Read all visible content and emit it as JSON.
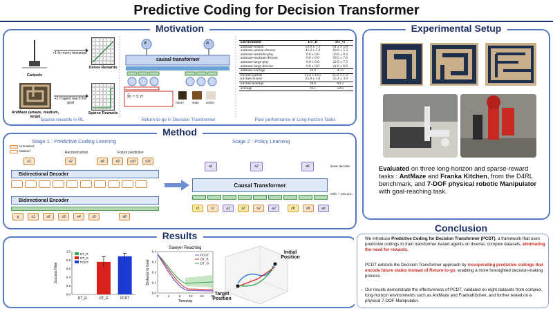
{
  "title": "Predictive Coding for Decision Transformer",
  "motivation": {
    "heading": "Motivation",
    "cartpole_label": "Cartpole",
    "cartpole_reward_text": "+1 for every timesteps",
    "dense_label": "Dense Rewards",
    "antmaze_label": "AntMaze (amaze, medium, large)",
    "antmaze_reward_text": "+1 if agent reach the goal",
    "sparse_label": "Sparse Rewards",
    "causal_label": "causal transformer",
    "a_t1": "a",
    "a_t": "a",
    "rtg_formula": "R̂t = Σ rt'",
    "ct_labels": [
      "return",
      "state",
      "action"
    ],
    "captions": [
      "Sparse rewards in RL",
      "Return-to-go in Decision Transformer",
      "Poor performance in Long-horizon Tasks"
    ],
    "table": {
      "headers": [
        "Environment",
        "DT_R",
        "DT_G"
      ],
      "rows": [
        [
          "antmaze-umaze",
          "53.0 ± 7.3",
          "61.2 ± 5.8"
        ],
        [
          "antmaze-umaze-diverse",
          "42.2 ± 5.4",
          "60.0 ± 5.3"
        ],
        [
          "antmaze-medium-play",
          "0.0 ± 0.0",
          "56.0 ± 9.4"
        ],
        [
          "antmaze-medium-diverse",
          "0.0 ± 0.0",
          "59.5 ± 7.6"
        ],
        [
          "antmaze-large-play",
          "0.0 ± 0.0",
          "22.0 ± 7.5"
        ],
        [
          "antmaze-large-diverse",
          "0.0 ± 0.0",
          "21.0 ± 6.6"
        ],
        [
          "antmaze average",
          "16.0",
          "47.6"
        ],
        [
          "kitchen-partial",
          "31.4 ± 19.5",
          "65.2 ± 1.9"
        ],
        [
          "kitchen-mixed",
          "25.8 ± 5.0",
          "55.4 ± 3.8"
        ],
        [
          "kitchen average",
          "28.6",
          "60.3"
        ],
        [
          "average",
          "19.1",
          "50.8"
        ]
      ]
    }
  },
  "method": {
    "heading": "Method",
    "stage1": "Stage 1 : Predictive Coding Learning",
    "stage2": "Stage 2 : Policy Learning",
    "legend_unmasked": "Unmasked",
    "legend_masked": "Masked",
    "reconstruction": "Reconstruction",
    "future_prediction": "Future prediction",
    "decoder": "Bidirectional Decoder",
    "encoder": "Bidirectional Encoder",
    "causal": "Causal Transformer",
    "linear_decoder": "linear decoder",
    "emb": "emb. + pos.enc.",
    "top_tokens": [
      "s1",
      "s2",
      "s8",
      "s9",
      "s10",
      "s16"
    ],
    "enc_tokens": [
      "g",
      "s1",
      "s2",
      "s3",
      "s4",
      "s5",
      "s8"
    ],
    "action_tokens": [
      "a1",
      "a2",
      "aK"
    ],
    "seq_tokens": [
      "z1",
      "s1",
      "a1",
      "z2",
      "s2",
      "a2",
      "zK",
      "sK",
      "aK"
    ]
  },
  "results": {
    "heading": "Results",
    "bar_chart": {
      "ylabel": "Success Rate",
      "categories": [
        "DT_R",
        "DT_G",
        "PCDT"
      ],
      "legend": [
        "DT_R",
        "DT_G",
        "PCDT"
      ],
      "colors": [
        "#2db34a",
        "#d9201c",
        "#1a3ad1"
      ],
      "values": [
        0.0,
        0.76,
        0.89
      ],
      "errors": [
        0.0,
        0.12,
        0.07
      ],
      "yticks": [
        "0.0",
        "0.2",
        "0.4",
        "0.6",
        "0.8",
        "1.0"
      ]
    },
    "line_chart": {
      "title": "Sawyer Reaching",
      "xlabel": "Timestep",
      "ylabel": "Distance to Goal",
      "legend": [
        "PCDT",
        "DT_R",
        "DT_G"
      ],
      "xticks": [
        "0",
        "4",
        "8",
        "12",
        "16",
        "20"
      ],
      "yticks": [
        "0.0",
        "0.1",
        "0.2",
        "0.3",
        "0.4"
      ]
    },
    "plot3d": {
      "initial": "Initial Position",
      "target": "Target Position"
    }
  },
  "setup": {
    "heading": "Experimental Setup",
    "text_parts": [
      "Evaluated",
      " on three long-horizon and sparse-reward tasks : ",
      "AntMaze",
      " and ",
      "Franka Kitchen",
      ", from the D4RL benchmark, and ",
      "7-DOF physical robotic Manipulator",
      " with goal-reaching task."
    ]
  },
  "conclusion": {
    "heading": "Conclusion",
    "p1_parts": [
      "We introduce ",
      "Predictive Coding for Decision Transformer (PCDT)",
      ", a framework that uses predictive codings to train transformer-based agents on diverse, complex datasets, ",
      "eliminating the need for rewards."
    ],
    "p2_parts": [
      "PCDT extends the Decision Transformer approach by ",
      "incorporating predictive codings that encode future states instead of Return-to-go",
      ", enabling a more foresighted decision-making process."
    ],
    "p3": "Our results demonstrate the effectiveness of PCDT, validated on eight datasets from complex, long-horizon environments such as AntMaze and FrankaKitchen, and further tested on a physical 7-DOF Manipulator."
  }
}
